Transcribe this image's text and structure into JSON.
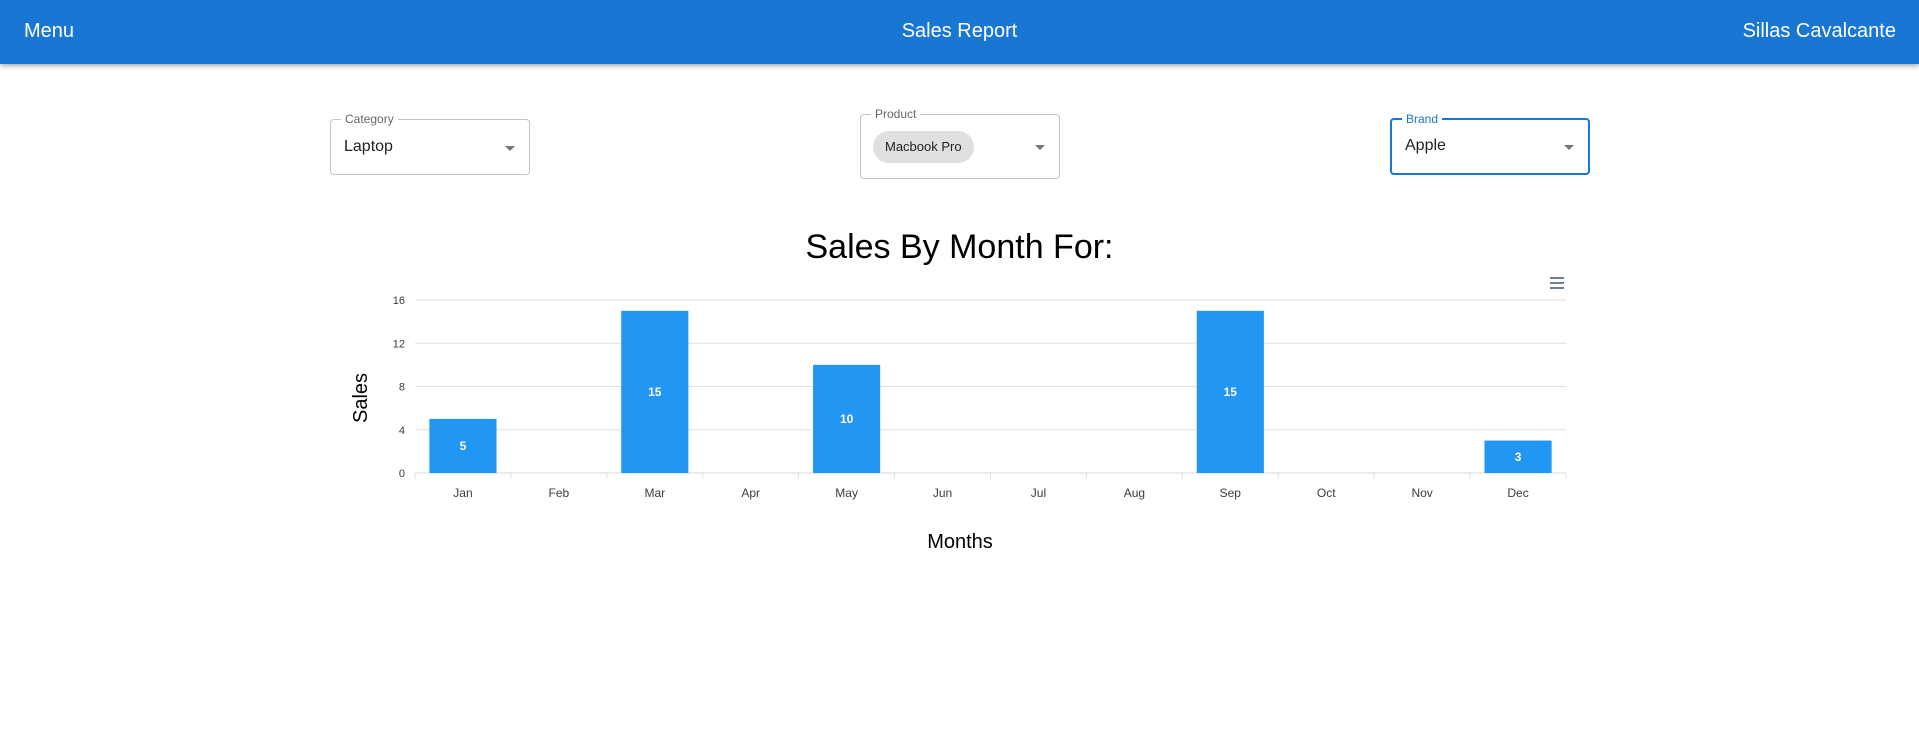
{
  "appbar": {
    "menu_label": "Menu",
    "title": "Sales Report",
    "user_name": "Sillas Cavalcante",
    "color": "#1976d2"
  },
  "filters": {
    "category": {
      "label": "Category",
      "value": "Laptop"
    },
    "product": {
      "label": "Product",
      "selected": [
        "Macbook Pro"
      ]
    },
    "brand": {
      "label": "Brand",
      "value": "Apple"
    }
  },
  "chart_data": {
    "type": "bar",
    "title": "Sales By Month For:",
    "xlabel": "Months",
    "ylabel": "Sales",
    "categories": [
      "Jan",
      "Feb",
      "Mar",
      "Apr",
      "May",
      "Jun",
      "Jul",
      "Aug",
      "Sep",
      "Oct",
      "Nov",
      "Dec"
    ],
    "values": [
      5,
      0,
      15,
      0,
      10,
      0,
      0,
      0,
      15,
      0,
      0,
      3
    ],
    "data_labels": [
      "5",
      "",
      "15",
      "",
      "10",
      "",
      "",
      "",
      "15",
      "",
      "",
      "3"
    ],
    "ylim": [
      0,
      16
    ],
    "yticks": [
      "0",
      "4",
      "8",
      "12",
      "16"
    ],
    "grid": true,
    "bar_color": "#2196f3",
    "label_color": "#ffffff"
  },
  "icons": {
    "chart_menu": "hamburger-menu-icon",
    "dropdown": "caret-down-icon"
  }
}
